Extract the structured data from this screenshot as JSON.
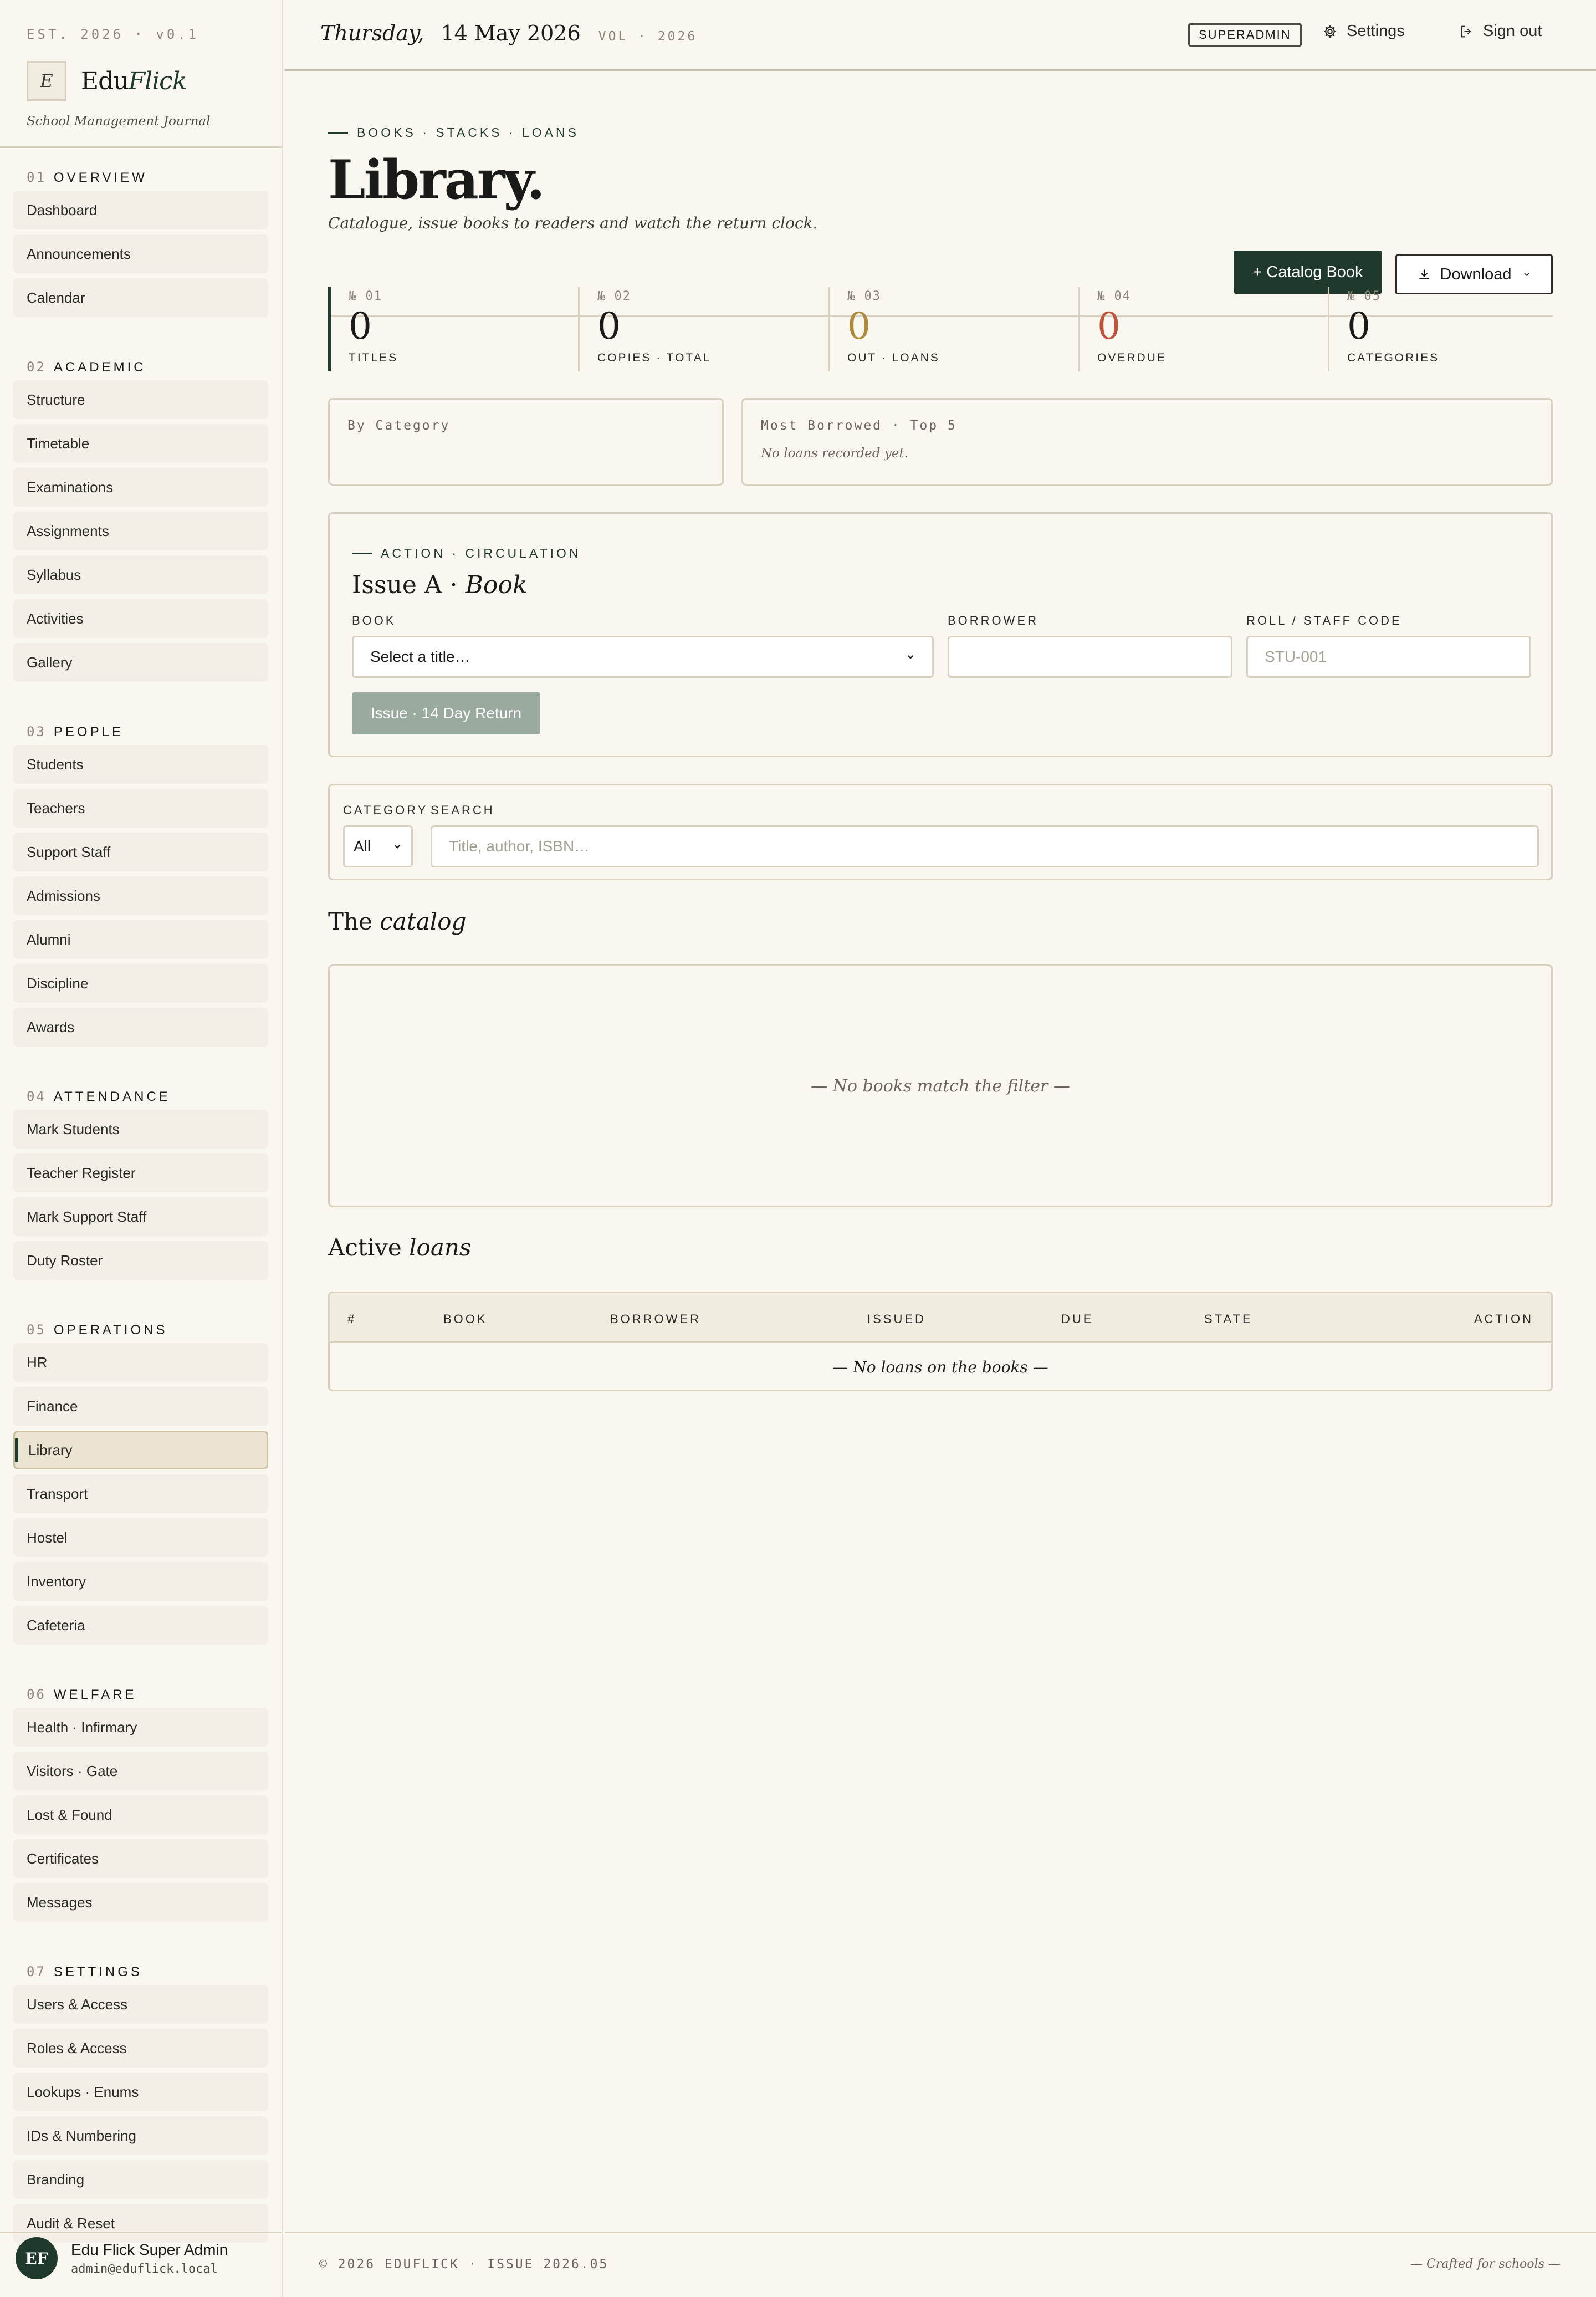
{
  "brand": {
    "est": "EST. 2026 · v0.1",
    "logo_letter": "E",
    "name_plain": "Edu",
    "name_italic": "Flick",
    "tagline": "School Management Journal"
  },
  "sidebar": {
    "sections": [
      {
        "num": "01",
        "title": "OVERVIEW",
        "items": [
          "Dashboard",
          "Announcements",
          "Calendar"
        ]
      },
      {
        "num": "02",
        "title": "ACADEMIC",
        "items": [
          "Structure",
          "Timetable",
          "Examinations",
          "Assignments",
          "Syllabus",
          "Activities",
          "Gallery"
        ]
      },
      {
        "num": "03",
        "title": "PEOPLE",
        "items": [
          "Students",
          "Teachers",
          "Support Staff",
          "Admissions",
          "Alumni",
          "Discipline",
          "Awards"
        ]
      },
      {
        "num": "04",
        "title": "ATTENDANCE",
        "items": [
          "Mark Students",
          "Teacher Register",
          "Mark Support Staff",
          "Duty Roster"
        ]
      },
      {
        "num": "05",
        "title": "OPERATIONS",
        "items": [
          "HR",
          "Finance",
          "Library",
          "Transport",
          "Hostel",
          "Inventory",
          "Cafeteria"
        ]
      },
      {
        "num": "06",
        "title": "WELFARE",
        "items": [
          "Health · Infirmary",
          "Visitors · Gate",
          "Lost & Found",
          "Certificates",
          "Messages"
        ]
      },
      {
        "num": "07",
        "title": "SETTINGS",
        "items": [
          "Users & Access",
          "Roles & Access",
          "Lookups · Enums",
          "IDs & Numbering",
          "Branding",
          "Audit & Reset"
        ]
      }
    ],
    "active_item": "Library"
  },
  "user": {
    "initials": "EF",
    "name": "Edu Flick Super Admin",
    "email": "admin@eduflick.local"
  },
  "topbar": {
    "weekday": "Thursday,",
    "date": "14 May 2026",
    "vol": "VOL · 2026",
    "role": "SUPERADMIN",
    "settings_label": "Settings",
    "signout_label": "Sign out"
  },
  "page": {
    "eyebrow": "BOOKS · STACKS · LOANS",
    "title": "Library.",
    "subtitle": "Catalogue, issue books to readers and watch the return clock.",
    "catalog_button": "+ Catalog Book",
    "download_button": "Download"
  },
  "stats": [
    {
      "num": "№ 01",
      "value": "0",
      "label": "TITLES",
      "color": "#1a1a18"
    },
    {
      "num": "№ 02",
      "value": "0",
      "label": "COPIES · TOTAL",
      "color": "#1a1a18"
    },
    {
      "num": "№ 03",
      "value": "0",
      "label": "OUT · LOANS",
      "color": "#b08a3c"
    },
    {
      "num": "№ 04",
      "value": "0",
      "label": "OVERDUE",
      "color": "#c0533a"
    },
    {
      "num": "№ 05",
      "value": "0",
      "label": "CATEGORIES",
      "color": "#1a1a18"
    }
  ],
  "panels": {
    "by_category_label": "By Category",
    "most_borrowed_label": "Most Borrowed · Top 5",
    "most_borrowed_empty": "No loans recorded yet."
  },
  "issue": {
    "eyebrow": "ACTION · CIRCULATION",
    "title_plain": "Issue A · ",
    "title_italic": "Book",
    "book_label": "BOOK",
    "book_value": "Select a title…",
    "borrower_label": "BORROWER",
    "borrower_value": "",
    "code_label": "ROLL / STAFF CODE",
    "code_placeholder": "STU-001",
    "button": "Issue · 14 Day Return"
  },
  "filter": {
    "category_label": "CATEGORY",
    "category_value": "All",
    "search_label": "SEARCH",
    "search_placeholder": "Title, author, ISBN…"
  },
  "catalog": {
    "title_plain": "The ",
    "title_italic": "catalog",
    "empty": "— No books match the filter —"
  },
  "loans": {
    "title_plain": "Active ",
    "title_italic": "loans",
    "columns": [
      "#",
      "BOOK",
      "BORROWER",
      "ISSUED",
      "DUE",
      "STATE",
      "ACTION"
    ],
    "empty": "— No loans on the books —"
  },
  "footer": {
    "left": "© 2026 EDUFLICK · ISSUE 2026.05",
    "right": "— Crafted for schools —"
  },
  "colors": {
    "accent": "#1f3a2c",
    "warning": "#b08a3c",
    "danger": "#c0533a"
  }
}
